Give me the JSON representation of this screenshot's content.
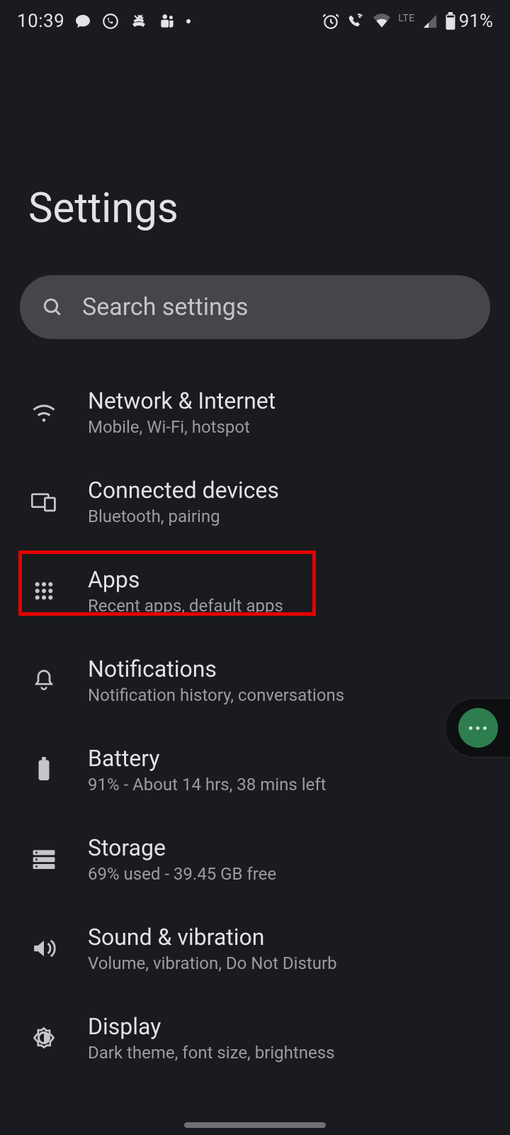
{
  "status": {
    "time": "10:39",
    "battery_text": "91%"
  },
  "page": {
    "title": "Settings"
  },
  "search": {
    "placeholder": "Search settings"
  },
  "items": [
    {
      "title": "Network & Internet",
      "subtitle": "Mobile, Wi-Fi, hotspot"
    },
    {
      "title": "Connected devices",
      "subtitle": "Bluetooth, pairing"
    },
    {
      "title": "Apps",
      "subtitle": "Recent apps, default apps"
    },
    {
      "title": "Notifications",
      "subtitle": "Notification history, conversations"
    },
    {
      "title": "Battery",
      "subtitle": "91% - About 14 hrs, 38 mins left"
    },
    {
      "title": "Storage",
      "subtitle": "69% used - 39.45 GB free"
    },
    {
      "title": "Sound & vibration",
      "subtitle": "Volume, vibration, Do Not Disturb"
    },
    {
      "title": "Display",
      "subtitle": "Dark theme, font size, brightness"
    }
  ],
  "highlight_index": 2
}
